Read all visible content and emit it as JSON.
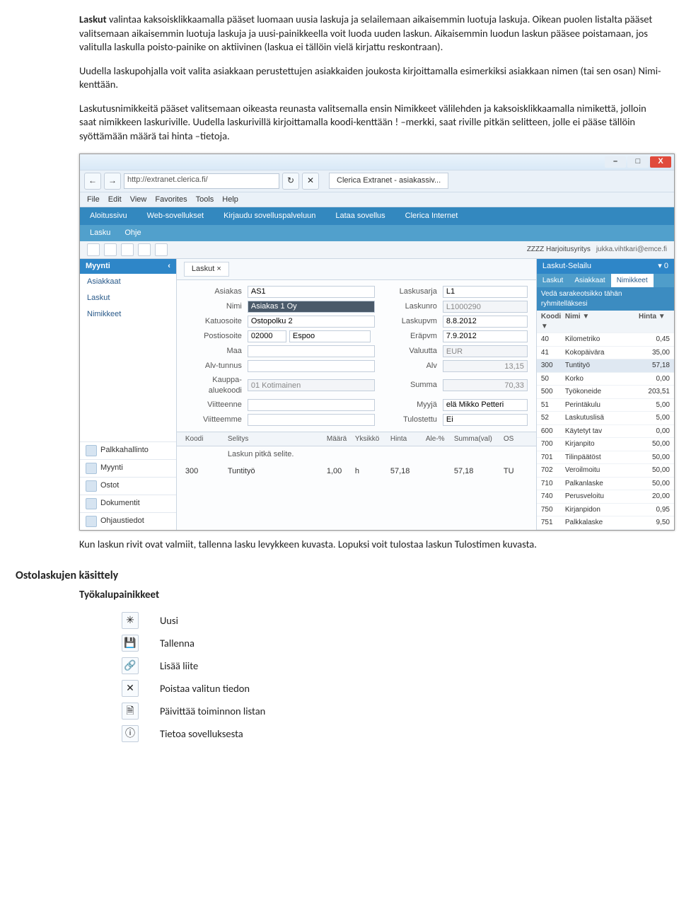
{
  "doc": {
    "p1_lead": "Laskut",
    "p1_rest": " valintaa kaksoisklikkaamalla pääset luomaan uusia laskuja ja selailemaan aikaisemmin luotuja laskuja. Oikean puolen listalta pääset valitsemaan aikaisemmin luotuja laskuja ja uusi-painikkeella voit luoda uuden laskun. Aikaisemmin luodun laskun pääsee poistamaan, jos valitulla laskulla poisto-painike on aktiivinen (laskua ei tällöin vielä kirjattu reskontraan).",
    "p2": "Uudella laskupohjalla voit valita asiakkaan perustettujen asiakkaiden joukosta kirjoittamalla esimerkiksi asiakkaan nimen (tai sen osan) Nimi-kenttään.",
    "p3": "Laskutusnimikkeitä pääset valitsemaan oikeasta reunasta valitsemalla ensin Nimikkeet välilehden ja kaksoisklikkaamalla nimikettä, jolloin saat nimikkeen laskuriville. Uudella laskurivillä kirjoittamalla koodi-kenttään ! –merkki, saat riville pitkän selitteen, jolle ei pääse tällöin syöttämään määrä tai hinta –tietoja.",
    "p4": "Kun laskun rivit ovat valmiit, tallenna lasku levykkeen kuvasta. Lopuksi voit tulostaa laskun Tulostimen kuvasta.",
    "h_osto": "Ostolaskujen käsittely",
    "h_tyokalu": "Työkalupainikkeet",
    "tools": {
      "uusi": "Uusi",
      "tallenna": "Tallenna",
      "liite": "Lisää liite",
      "poista": "Poistaa valitun tiedon",
      "paivita": "Päivittää toiminnon listan",
      "tietoa": "Tietoa sovelluksesta"
    }
  },
  "shot": {
    "minus": "–",
    "square": "□",
    "x": "X",
    "back": "←",
    "fwd": "→",
    "url": "http://extranet.clerica.fi/",
    "tab": "Clerica Extranet - asiakassiv...",
    "ie": {
      "file": "File",
      "edit": "Edit",
      "view": "View",
      "fav": "Favorites",
      "tools": "Tools",
      "help": "Help"
    },
    "menu1": [
      "Aloitussivu",
      "Web-sovellukset",
      "Kirjaudu sovelluspalveluun",
      "Lataa sovellus",
      "Clerica Internet"
    ],
    "menu2": [
      "Lasku",
      "Ohje"
    ],
    "company": "ZZZZ Harjoitusyritys",
    "user": "jukka.vihtkari@emce.fi",
    "leftHeader": "Myynti",
    "leftCollapse": "‹",
    "leftItems": [
      "Asiakkaat",
      "Laskut",
      "Nimikkeet"
    ],
    "modules": [
      "Palkkahallinto",
      "Myynti",
      "Ostot",
      "Dokumentit",
      "Ohjaustiedot"
    ],
    "tab_label": "Laskut",
    "tab_close": "×",
    "form": {
      "asiakas_l": "Asiakas",
      "asiakas_v": "AS1",
      "nimi_l": "Nimi",
      "nimi_v": "Asiakas 1 Oy",
      "katu_l": "Katuosoite",
      "katu_v": "Ostopolku 2",
      "posti_l": "Postiosoite",
      "posti_z": "02000",
      "posti_c": "Espoo",
      "maa_l": "Maa",
      "maa_v": "",
      "alv_l": "Alv-tunnus",
      "alv_v": "",
      "kauppa_l": "Kauppa-aluekoodi",
      "kauppa_v": "01 Kotimainen",
      "viitteenne_l": "Viitteenne",
      "viitteenne_v": "",
      "viitteemme_l": "Viitteemme",
      "viitteemme_v": "",
      "sarja_l": "Laskusarja",
      "sarja_v": "L1",
      "nro_l": "Laskunro",
      "nro_v": "L1000290",
      "pvm_l": "Laskupvm",
      "pvm_v": "8.8.2012",
      "era_l": "Eräpvm",
      "era_v": "7.9.2012",
      "val_l": "Valuutta",
      "val_v": "EUR",
      "alvr_l": "Alv",
      "alvr_v": "13,15",
      "sum_l": "Summa",
      "sum_v": "70,33",
      "myy_l": "Myyjä",
      "myy_v": "elä Mikko Petteri",
      "tul_l": "Tulostettu",
      "tul_v": "Ei"
    },
    "linehdr": [
      "Koodi",
      "Selitys",
      "Määrä",
      "Yksikkö",
      "Hinta",
      "Ale-%",
      "Summa(val)",
      "OS"
    ],
    "note": "Laskun pitkä selite.",
    "line": {
      "koodi": "300",
      "selitys": "Tuntityö",
      "maara": "1,00",
      "yks": "h",
      "hinta": "57,18",
      "ale": "",
      "summa": "57,18",
      "os": "TU"
    },
    "right": {
      "title": "Laskut-Selailu",
      "pin": "▾ 0",
      "tabs": [
        "Laskut",
        "Asiakkaat",
        "Nimikkeet"
      ],
      "instr": "Vedä sarakeotsikko tähän ryhmitelläksesi",
      "cols": [
        "Koodi",
        "Nimi",
        "Hinta"
      ],
      "filter": "▼",
      "rows": [
        {
          "k": "40",
          "n": "Kilometriko",
          "h": "0,45"
        },
        {
          "k": "41",
          "n": "Kokopäivära",
          "h": "35,00"
        },
        {
          "k": "300",
          "n": "Tuntityö",
          "h": "57,18",
          "sel": true
        },
        {
          "k": "50",
          "n": "Korko",
          "h": "0,00"
        },
        {
          "k": "500",
          "n": "Työkoneide",
          "h": "203,51"
        },
        {
          "k": "51",
          "n": "Perintäkulu",
          "h": "5,00"
        },
        {
          "k": "52",
          "n": "Laskutuslisä",
          "h": "5,00"
        },
        {
          "k": "600",
          "n": "Käytetyt tav",
          "h": "0,00"
        },
        {
          "k": "700",
          "n": "Kirjanpito",
          "h": "50,00"
        },
        {
          "k": "701",
          "n": "Tilinpäätöst",
          "h": "50,00"
        },
        {
          "k": "702",
          "n": "Veroilmoitu",
          "h": "50,00"
        },
        {
          "k": "710",
          "n": "Palkanlaske",
          "h": "50,00"
        },
        {
          "k": "740",
          "n": "Perusveloitu",
          "h": "20,00"
        },
        {
          "k": "750",
          "n": "Kirjanpidon",
          "h": "0,95"
        },
        {
          "k": "751",
          "n": "Palkkalaske",
          "h": "9,50"
        }
      ]
    }
  },
  "icons": {
    "uusi": "✳",
    "tallenna": "💾",
    "liite": "🔗",
    "poista": "✕",
    "paivita": "🗎",
    "tietoa": "ⓘ"
  }
}
